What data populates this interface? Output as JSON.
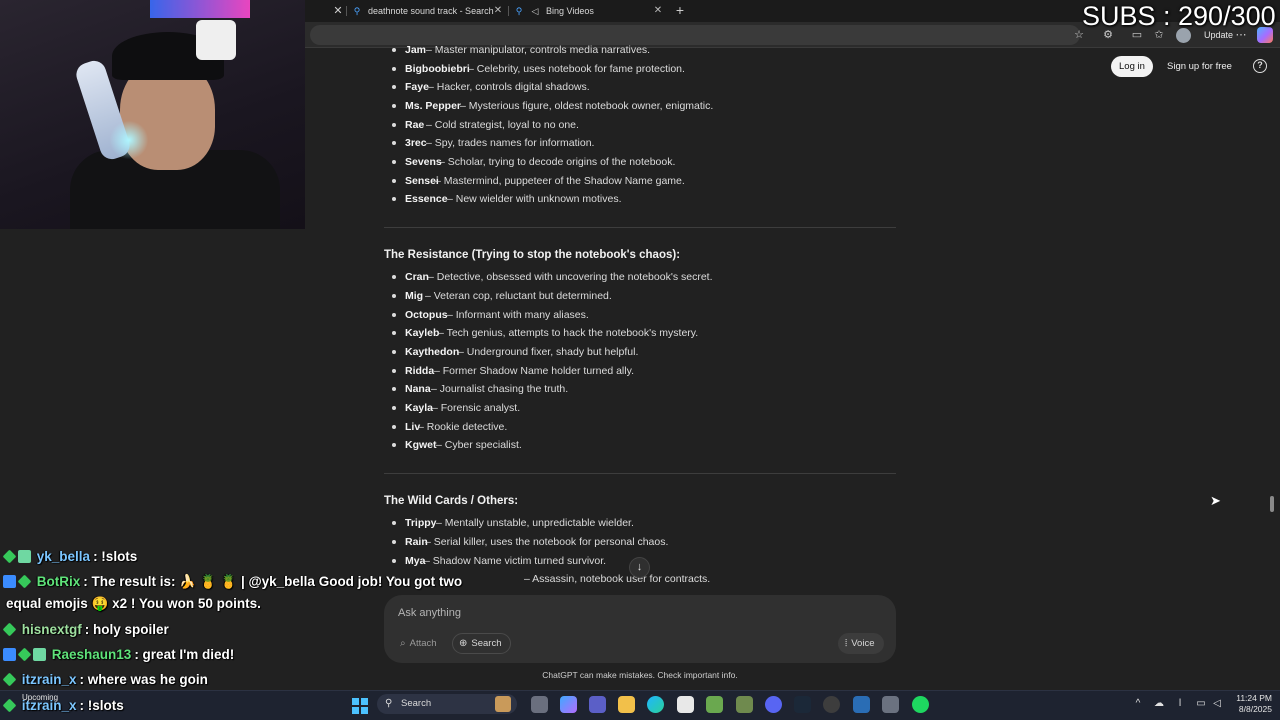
{
  "browser": {
    "tabs": [
      {
        "label": "deathnote sound track - Search"
      },
      {
        "label": "Bing Videos"
      }
    ],
    "update_label": "Update"
  },
  "overlay": {
    "subs": "SUBS : 290/300"
  },
  "chatgpt": {
    "login_label": "Log in",
    "signup_label": "Sign up for free",
    "help_label": "?",
    "top_list": [
      {
        "name": "Jam",
        "desc": " – Master manipulator, controls media narratives."
      },
      {
        "name": "Bigboobiebri",
        "desc": " – Celebrity, uses notebook for fame protection."
      },
      {
        "name": "Faye",
        "desc": " – Hacker, controls digital shadows."
      },
      {
        "name": "Ms. Pepper",
        "desc": " – Mysterious figure, oldest notebook owner, enigmatic."
      },
      {
        "name": "Rae",
        "desc": " – Cold strategist, loyal to no one."
      },
      {
        "name": "3rec",
        "desc": " – Spy, trades names for information."
      },
      {
        "name": "Sevens",
        "desc": " – Scholar, trying to decode origins of the notebook."
      },
      {
        "name": "Sensei",
        "desc": " – Mastermind, puppeteer of the Shadow Name game."
      },
      {
        "name": "Essence",
        "desc": " – New wielder with unknown motives."
      }
    ],
    "resistance_title": "The Resistance (Trying to stop the notebook's chaos):",
    "resistance_list": [
      {
        "name": "Cran",
        "desc": " – Detective, obsessed with uncovering the notebook's secret."
      },
      {
        "name": "Mig",
        "desc": " – Veteran cop, reluctant but determined."
      },
      {
        "name": "Octopus",
        "desc": " – Informant with many aliases."
      },
      {
        "name": "Kayleb",
        "desc": " – Tech genius, attempts to hack the notebook's mystery."
      },
      {
        "name": "Kaythedon",
        "desc": " – Underground fixer, shady but helpful."
      },
      {
        "name": "Ridda",
        "desc": " – Former Shadow Name holder turned ally."
      },
      {
        "name": "Nana",
        "desc": " – Journalist chasing the truth."
      },
      {
        "name": "Kayla",
        "desc": " – Forensic analyst."
      },
      {
        "name": "Liv",
        "desc": " – Rookie detective."
      },
      {
        "name": "Kgwet",
        "desc": " – Cyber specialist."
      }
    ],
    "wild_title": "The Wild Cards / Others:",
    "wild_list": [
      {
        "name": "Trippy",
        "desc": " – Mentally unstable, unpredictable wielder."
      },
      {
        "name": "Rain",
        "desc": " – Serial killer, uses the notebook for personal chaos."
      },
      {
        "name": "Mya",
        "desc": " – Shadow Name victim turned survivor."
      },
      {
        "name": "",
        "desc": "– Assassin, notebook user for contracts."
      }
    ],
    "composer": {
      "placeholder": "Ask anything",
      "attach_label": "Attach",
      "search_label": "Search",
      "voice_label": "Voice"
    },
    "disclaimer": "ChatGPT can make mistakes. Check important info."
  },
  "stream_chat": [
    {
      "user": "yk_bella",
      "message": ": !slots",
      "user_color": "blue"
    },
    {
      "user": "BotRix",
      "message": ": The result is: 🍌 🍍 🍍 | @yk_bella Good job! You got two",
      "user_color": "green"
    },
    {
      "user": "",
      "message": "equal emojis 🤑 x2 ! You won 50 points.",
      "user_color": "white"
    },
    {
      "user": "hisnextgf",
      "message": ": holy spoiler",
      "user_color": "blue"
    },
    {
      "user": "Raeshaun13",
      "message": ": great I'm died!",
      "user_color": "green"
    },
    {
      "user": "itzrain_x",
      "message": ": where was he goin",
      "user_color": "blue"
    },
    {
      "user": "itzrain_x",
      "message": ": !slots",
      "user_color": "blue"
    }
  ],
  "taskbar": {
    "upcoming_label": "Upcoming",
    "search_label": "Search",
    "time": "11:24 PM",
    "date": "8/8/2025"
  }
}
